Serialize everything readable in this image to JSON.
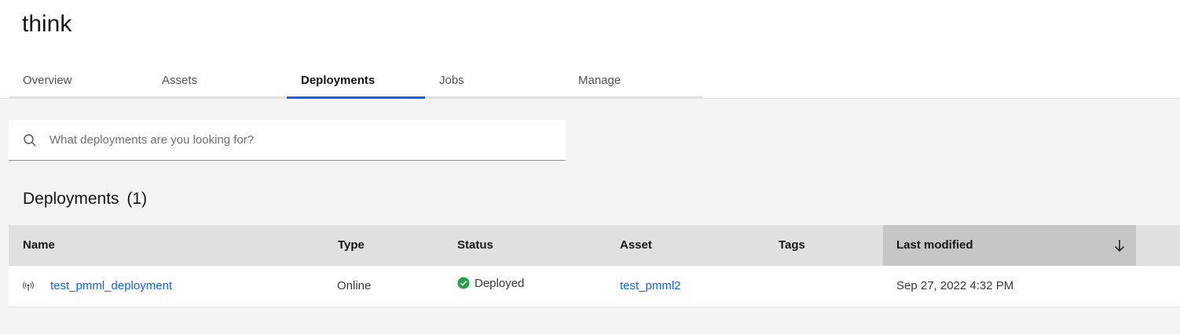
{
  "project": {
    "title": "think"
  },
  "tabs": [
    {
      "label": "Overview",
      "active": false
    },
    {
      "label": "Assets",
      "active": false
    },
    {
      "label": "Deployments",
      "active": true
    },
    {
      "label": "Jobs",
      "active": false
    },
    {
      "label": "Manage",
      "active": false
    }
  ],
  "search": {
    "placeholder": "What deployments are you looking for?",
    "value": ""
  },
  "section": {
    "title": "Deployments",
    "count": "(1)"
  },
  "table": {
    "columns": [
      "Name",
      "Type",
      "Status",
      "Asset",
      "Tags",
      "Last modified"
    ],
    "sorted_column": "Last modified",
    "sort_direction": "descending",
    "rows": [
      {
        "name": "test_pmml_deployment",
        "type": "Online",
        "status": "Deployed",
        "asset": "test_pmml2",
        "tags": "",
        "last_modified": "Sep 27, 2022 4:32 PM"
      }
    ]
  },
  "colors": {
    "accent": "#0f62fe",
    "success": "#24a148",
    "background": "#f4f4f4",
    "header_row": "#e0e0e0",
    "sorted_header": "#c6c6c6"
  },
  "icons": {
    "search": "search-icon",
    "sort": "arrow-down-icon",
    "status": "checkmark-filled-icon",
    "deployment_type": "radio-tower-icon"
  }
}
